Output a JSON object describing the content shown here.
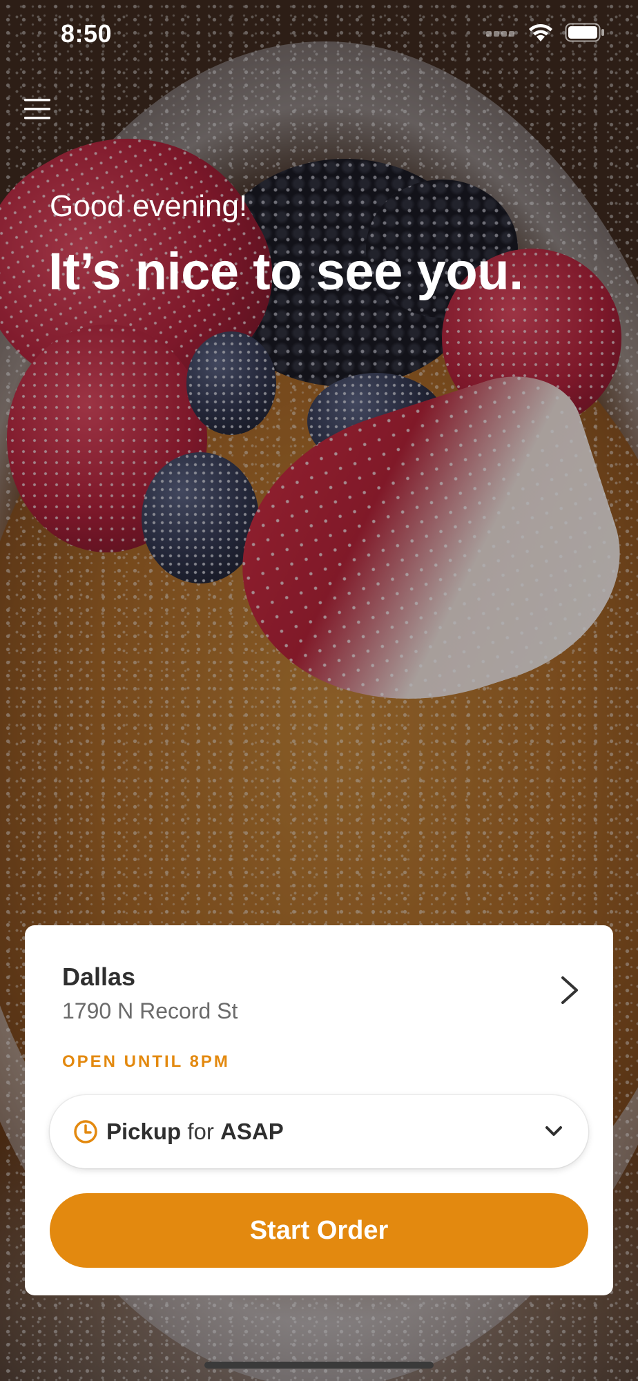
{
  "status_bar": {
    "time": "8:50",
    "icons": [
      "cellular-signal-icon",
      "wifi-icon",
      "battery-icon"
    ]
  },
  "header": {
    "menu_icon": "hamburger-menu-icon",
    "greeting": "Good evening!",
    "headline": "It’s nice to see you."
  },
  "background": {
    "image": "pancake with powdered sugar, raspberries, blackberries, blueberries and strawberries"
  },
  "location_card": {
    "store_name": "Dallas",
    "address": "1790 N Record St",
    "status": "OPEN UNTIL 8PM",
    "chevron_icon": "chevron-right-icon"
  },
  "order_options": {
    "mode": "Pickup",
    "connector": "for",
    "time": "ASAP",
    "clock_icon": "clock-icon",
    "dropdown_icon": "chevron-down-icon"
  },
  "cta": {
    "start_order_label": "Start Order"
  },
  "colors": {
    "accent": "#e3890f",
    "card_background": "#ffffff",
    "primary_text": "#2f2f2f",
    "secondary_text": "#6b6b6b"
  }
}
